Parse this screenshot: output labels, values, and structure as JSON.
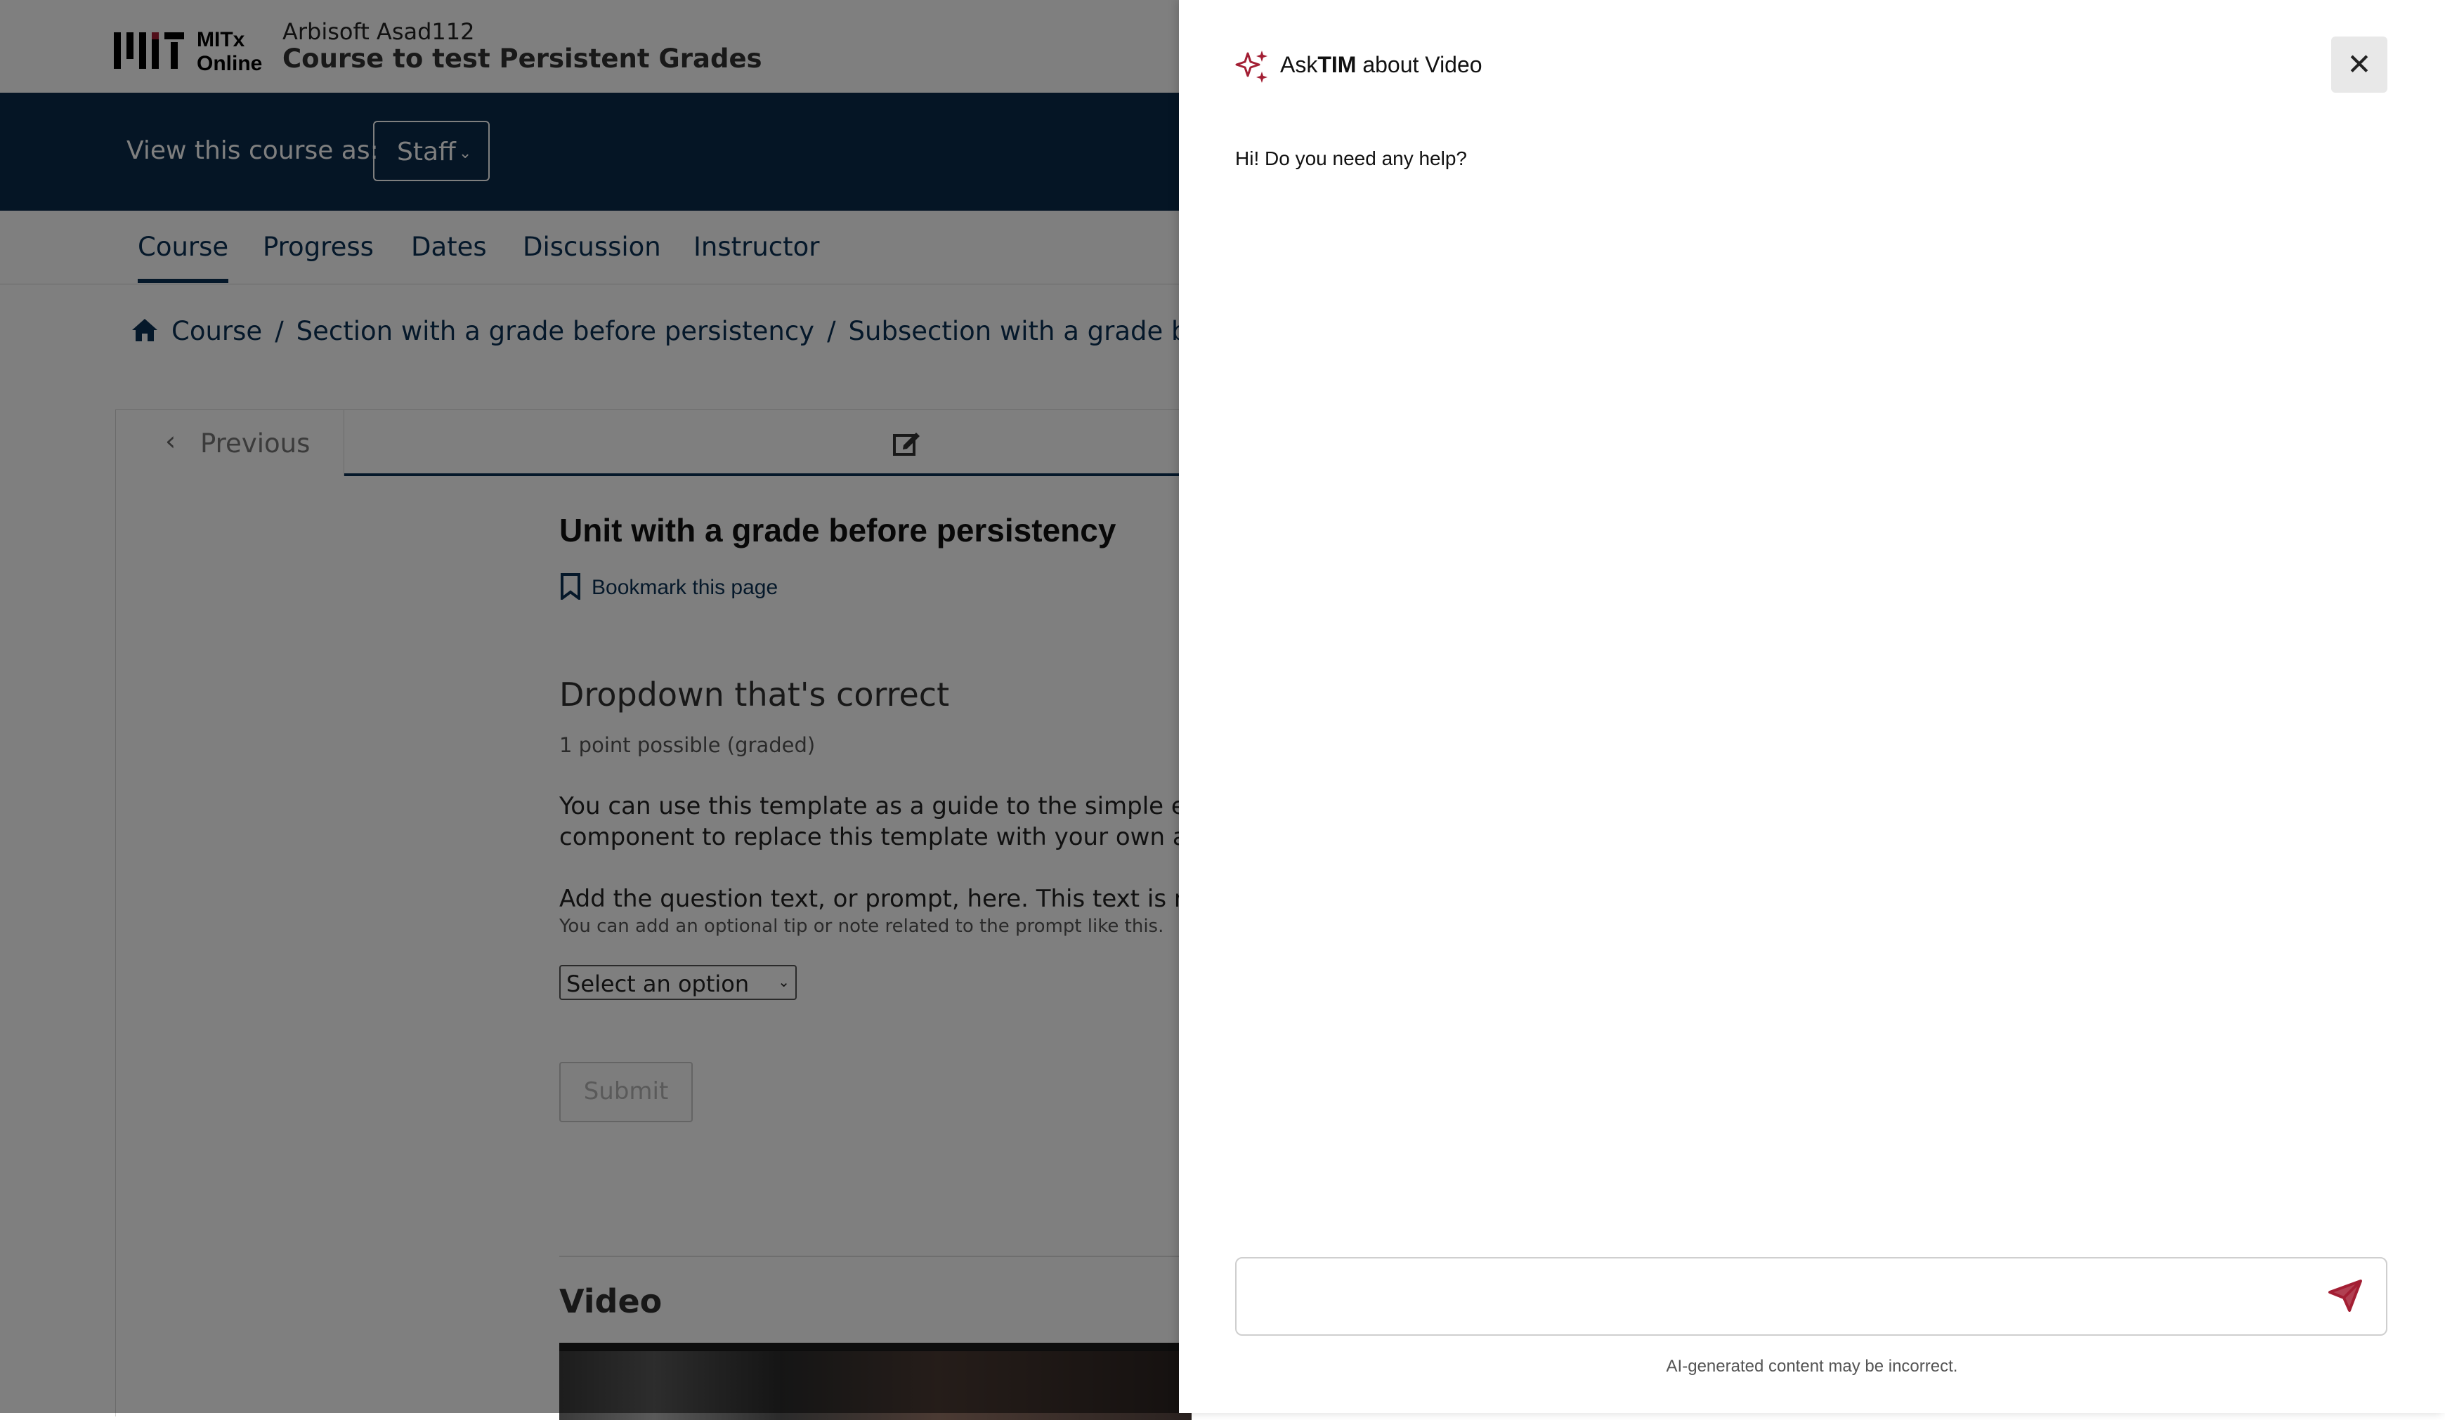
{
  "header": {
    "logo_line1": "MITx",
    "logo_line2": "Online",
    "course_org": "Arbisoft Asad112",
    "course_title": "Course to test Persistent Grades"
  },
  "masquerade": {
    "label": "View this course as:",
    "selected": "Staff"
  },
  "tabs": [
    {
      "label": "Course",
      "active": true
    },
    {
      "label": "Progress"
    },
    {
      "label": "Dates"
    },
    {
      "label": "Discussion"
    },
    {
      "label": "Instructor"
    }
  ],
  "breadcrumb": {
    "items": [
      "Course",
      "Section with a grade before persistency",
      "Subsection with a grade before persis"
    ],
    "separator": "/"
  },
  "sequence_nav": {
    "previous_label": "Previous"
  },
  "unit": {
    "title": "Unit with a grade before persistency",
    "bookmark_label": "Bookmark this page"
  },
  "problem": {
    "title": "Dropdown that's correct",
    "points": "1 point possible (graded)",
    "description_line1": "You can use this template as a guide to the simple editor m",
    "description_line2": "component to replace this template with your own assessm",
    "prompt": "Add the question text, or prompt, here. This text is required",
    "tip": "You can add an optional tip or note related to the prompt like this.",
    "dropdown_value": "Select an option",
    "submit_label": "Submit"
  },
  "video": {
    "title": "Video"
  },
  "drawer": {
    "title_prefix": "Ask",
    "title_brand": "TIM",
    "title_suffix": " about Video",
    "greeting": "Hi! Do you need any help?",
    "input_value": "",
    "disclaimer": "AI-generated content may be incorrect.",
    "accent_color": "#a31f34"
  }
}
